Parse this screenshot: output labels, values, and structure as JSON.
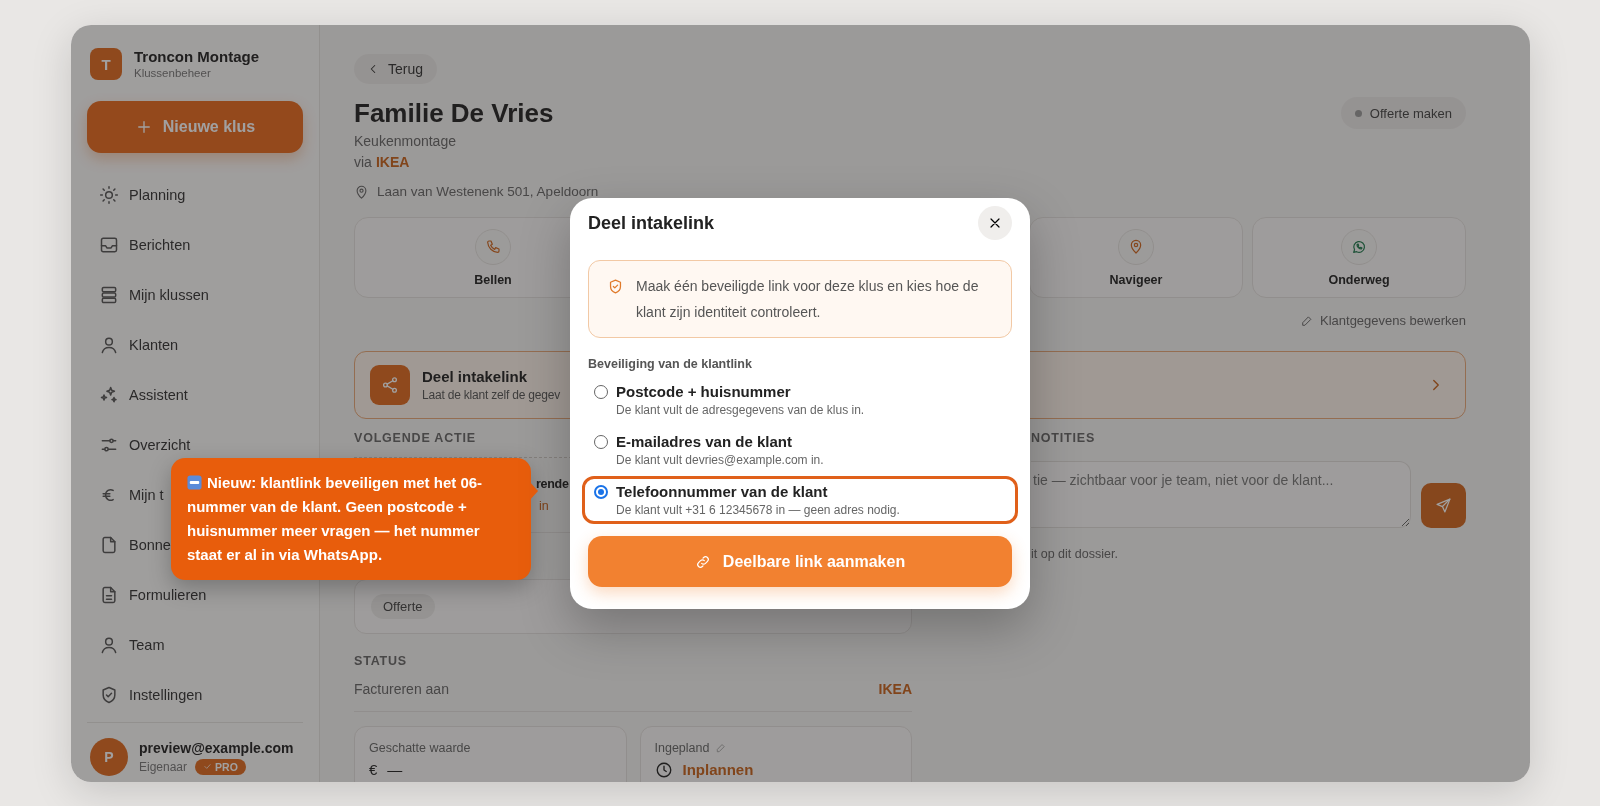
{
  "sidebar": {
    "brand": {
      "initial": "T",
      "name": "Troncon Montage",
      "subtitle": "Klussenbeheer"
    },
    "new_button": "Nieuwe klus",
    "nav": [
      {
        "label": "Planning"
      },
      {
        "label": "Berichten"
      },
      {
        "label": "Mijn klussen"
      },
      {
        "label": "Klanten"
      },
      {
        "label": "Assistent"
      },
      {
        "label": "Overzicht"
      },
      {
        "label": "Mijn t"
      },
      {
        "label": "Bonne"
      },
      {
        "label": "Formulieren"
      },
      {
        "label": "Team"
      },
      {
        "label": "Instellingen"
      }
    ],
    "user": {
      "initial": "P",
      "email": "preview@example.com",
      "role": "Eigenaar",
      "badge": "PRO"
    }
  },
  "main": {
    "back": "Terug",
    "title": "Familie De Vries",
    "subtitle": "Keukenmontage",
    "via_prefix": "via",
    "via_name": "IKEA",
    "address": "Laan van Westenenk 501, Apeldoorn",
    "status_pill": "Offerte maken",
    "actions": [
      {
        "label": "Bellen"
      },
      {
        "label": "Navigeer"
      },
      {
        "label": "Onderweg"
      }
    ],
    "edit_link": "Klantgegevens bewerken",
    "intake_banner": {
      "title": "Deel intakelink",
      "subtitle": "Laat de klant zelf de gegev"
    },
    "next_action": {
      "heading": "VOLGENDE ACTIE",
      "fragment_1": "rende",
      "fragment_2": "in",
      "tag": "Offerte"
    },
    "status": {
      "heading": "STATUS",
      "bill_label": "Factureren aan",
      "bill_value": "IKEA",
      "estimate_label": "Geschatte waarde",
      "currency": "€",
      "estimate_value": "—",
      "planned_label": "Ingepland",
      "planned_value": "Inplannen"
    },
    "notes": {
      "heading": "NOTITIES",
      "placeholder": "tie — zichtbaar voor je team, niet voor de klant...",
      "hint": "it op dit dossier."
    }
  },
  "tooltip": {
    "text": "Nieuw: klantlink beveiligen met het 06-nummer van de klant. Geen postcode + huisnummer meer vragen — het nummer staat er al in via WhatsApp."
  },
  "modal": {
    "title": "Deel intakelink",
    "info": "Maak één beveiligde link voor deze klus en kies hoe de klant zijn identiteit controleert.",
    "section_label": "Beveiliging van de klantlink",
    "options": [
      {
        "title": "Postcode + huisnummer",
        "description": "De klant vult de adresgegevens van de klus in.",
        "selected": false
      },
      {
        "title": "E-mailadres van de klant",
        "description": "De klant vult devries@example.com in.",
        "selected": false
      },
      {
        "title": "Telefoonnummer van de klant",
        "description": "De klant vult +31 6 12345678 in — geen adres nodig.",
        "selected": true
      }
    ],
    "button": "Deelbare link aanmaken"
  }
}
